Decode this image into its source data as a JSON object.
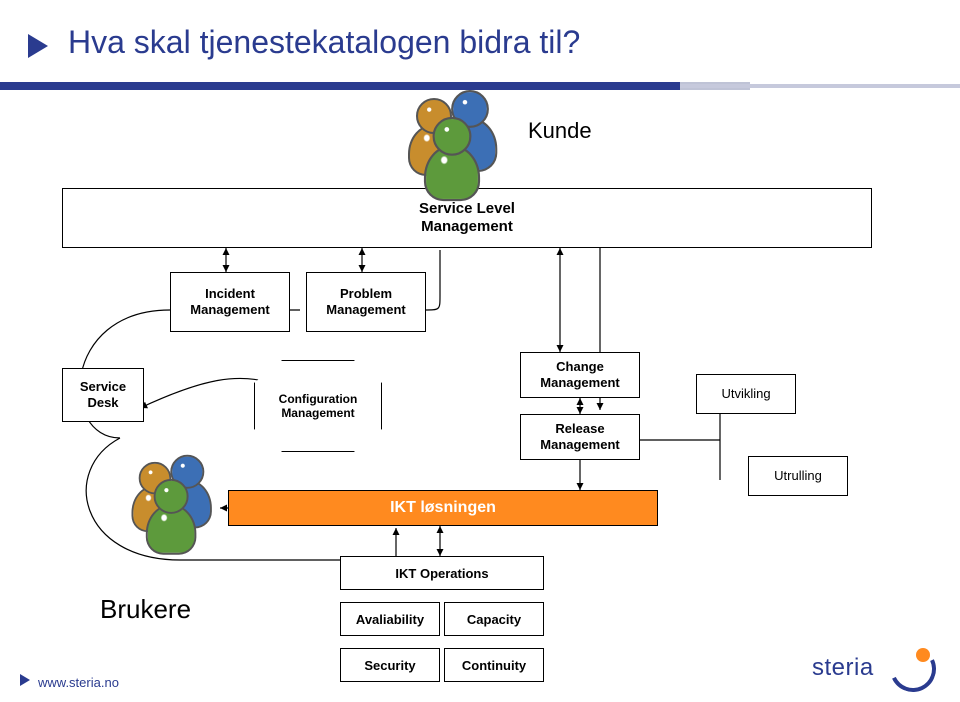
{
  "title": "Hva skal tjenestekatalogen bidra til?",
  "labels": {
    "kunde": "Kunde",
    "brukere": "Brukere",
    "utvikling": "Utvikling",
    "utrulling": "Utrulling"
  },
  "boxes": {
    "slm": {
      "line1": "Service Level",
      "line2": "Management"
    },
    "incident": {
      "line1": "Incident",
      "line2": "Management"
    },
    "problem": {
      "line1": "Problem",
      "line2": "Management"
    },
    "service_desk": {
      "line1": "Service",
      "line2": "Desk"
    },
    "configuration": {
      "line1": "Configuration",
      "line2": "Management"
    },
    "change": {
      "line1": "Change",
      "line2": "Management"
    },
    "release": {
      "line1": "Release",
      "line2": "Management"
    },
    "ikt_losningen": "IKT løsningen",
    "ikt_operations": "IKT Operations",
    "avail": "Avaliability",
    "capacity": "Capacity",
    "security": "Security",
    "continuity": "Continuity"
  },
  "footer": {
    "url": "www.steria.no",
    "logo_text": "steria"
  },
  "colors": {
    "brand_blue": "#2a3b8f",
    "accent_orange": "#ff8a1f"
  }
}
